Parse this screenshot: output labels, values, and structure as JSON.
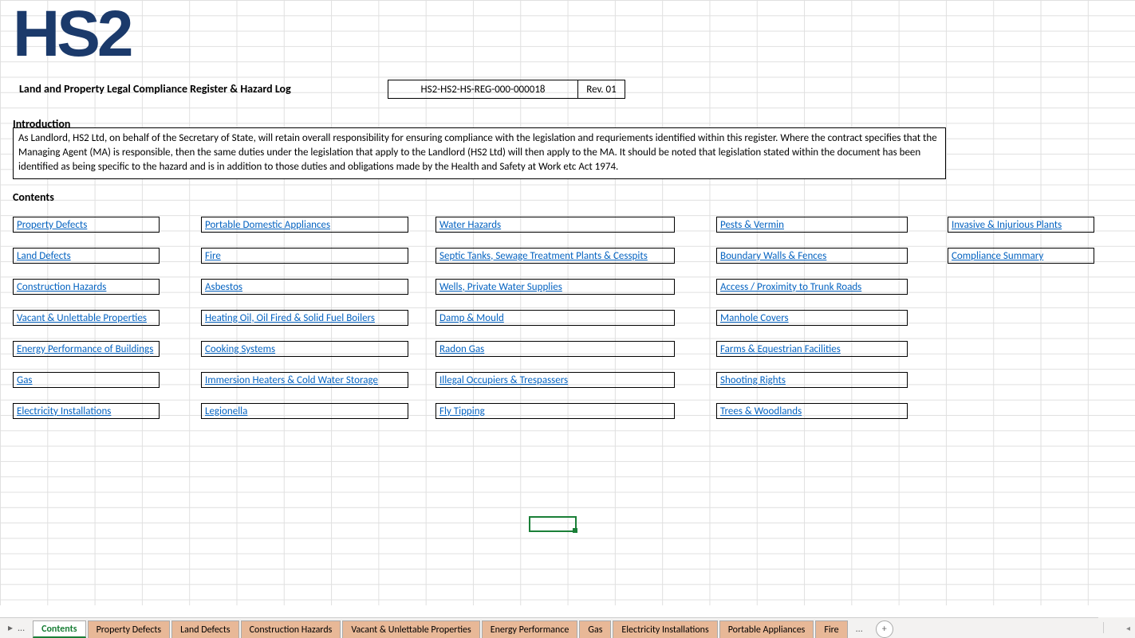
{
  "logo_text": "HS2",
  "doc_title": "Land and Property Legal Compliance Register & Hazard Log",
  "doc_id": "HS2-HS2-HS-REG-000-000018",
  "doc_rev": "Rev. 01",
  "headings": {
    "intro": "Introduction",
    "contents": "Contents"
  },
  "intro_text": "As Landlord, HS2 Ltd, on behalf of the Secretary of State, will retain overall responsibility for ensuring compliance with the legislation and requriements identified within this register.  Where the  contract specifies that the Managing Agent (MA) is responsible, then the same duties under the legislation that apply to the Landlord (HS2 Ltd) will then apply to the MA.   It should be noted that legislation stated within the document has been identified as being specific to the hazard and is in addition to those duties and obligations made by the Health and Safety at Work etc Act 1974.",
  "contents_links": {
    "col1": [
      "Property Defects",
      "Land Defects",
      "Construction Hazards",
      "Vacant & Unlettable Properties",
      "Energy Performance of Buildings",
      "Gas",
      "Electricity Installations"
    ],
    "col2": [
      "Portable Domestic Appliances",
      "Fire",
      "Asbestos",
      "Heating Oil, Oil Fired & Solid Fuel Boilers",
      "Cooking Systems ",
      "Immersion Heaters & Cold Water Storage",
      "Legionella"
    ],
    "col3": [
      "Water Hazards",
      "Septic Tanks, Sewage Treatment Plants & Cesspits",
      "Wells, Private Water Supplies",
      "Damp & Mould",
      "Radon Gas",
      "Illegal Occupiers & Trespassers",
      "Fly Tipping"
    ],
    "col4": [
      "Pests & Vermin",
      "Boundary Walls & Fences",
      "Access / Proximity to Trunk Roads",
      "Manhole Covers",
      "Farms & Equestrian Facilities",
      "Shooting Rights",
      "Trees & Woodlands"
    ],
    "col5": [
      "Invasive & Injurious Plants",
      "Compliance Summary"
    ]
  },
  "tabbar": {
    "nav_first": "▸",
    "nav_more_left": "...",
    "tabs": [
      {
        "label": "Contents",
        "active": true
      },
      {
        "label": "Property Defects",
        "active": false
      },
      {
        "label": "Land Defects",
        "active": false
      },
      {
        "label": "Construction Hazards",
        "active": false
      },
      {
        "label": "Vacant & Unlettable Properties",
        "active": false
      },
      {
        "label": "Energy Performance",
        "active": false
      },
      {
        "label": "Gas",
        "active": false
      },
      {
        "label": "Electricity Installations",
        "active": false
      },
      {
        "label": "Portable Appliances",
        "active": false
      },
      {
        "label": "Fire",
        "active": false
      }
    ],
    "nav_more_right": "...",
    "add": "+",
    "scroll_left_small": "◂",
    "scroll_right_small": "▸"
  }
}
